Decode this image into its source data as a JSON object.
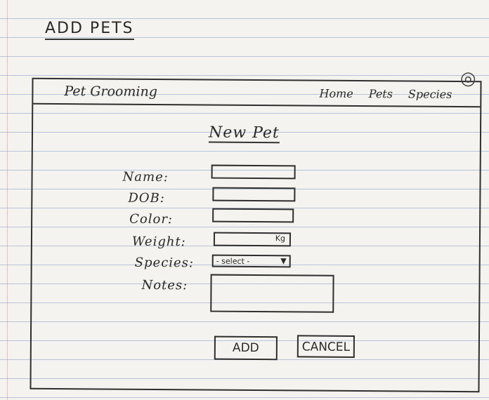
{
  "page_heading": "ADD PETS",
  "navbar": {
    "brand": "Pet Grooming",
    "links": [
      "Home",
      "Pets",
      "Species"
    ]
  },
  "form": {
    "title": "New Pet",
    "fields": {
      "name_label": "Name:",
      "dob_label": "DOB:",
      "color_label": "Color:",
      "weight_label": "Weight:",
      "weight_unit": "Kg",
      "species_label": "Species:",
      "species_selected": "- select -",
      "notes_label": "Notes:"
    },
    "buttons": {
      "add": "ADD",
      "cancel": "CANCEL"
    }
  },
  "icons": {
    "select_arrow": "chevron-down-icon",
    "corner": "page-curl-icon"
  }
}
